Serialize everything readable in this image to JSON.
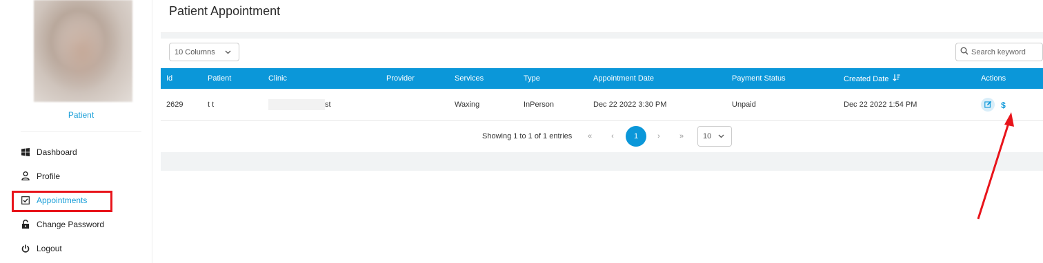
{
  "sidebar": {
    "role": "Patient",
    "nav": [
      {
        "label": "Dashboard",
        "icon": "windows-icon"
      },
      {
        "label": "Profile",
        "icon": "user-icon"
      },
      {
        "label": "Appointments",
        "icon": "checkbox-icon"
      },
      {
        "label": "Change Password",
        "icon": "lock-icon"
      },
      {
        "label": "Logout",
        "icon": "power-icon"
      }
    ],
    "active": "Appointments"
  },
  "header": {
    "title": "Patient Appointment"
  },
  "toolbar": {
    "columns_label": "10 Columns",
    "search_placeholder": "Search keyword"
  },
  "table": {
    "columns": [
      "Id",
      "Patient",
      "Clinic",
      "Provider",
      "Services",
      "Type",
      "Appointment Date",
      "Payment Status",
      "Created Date",
      "Actions"
    ],
    "rows": [
      {
        "id": "2629",
        "patient": "t t",
        "clinic": "st",
        "provider": "",
        "services": "Waxing",
        "type": "InPerson",
        "appointment_date": "Dec 22 2022 3:30 PM",
        "payment_status": "Unpaid",
        "created_date": "Dec 22 2022 1:54 PM",
        "pay_symbol": "$"
      }
    ]
  },
  "pagination": {
    "showing": "Showing 1 to 1 of 1 entries",
    "first": "«",
    "prev": "‹",
    "current": "1",
    "next": "›",
    "last": "»",
    "page_size": "10"
  },
  "colors": {
    "accent": "#0b97d9",
    "highlight": "#e8141b"
  }
}
